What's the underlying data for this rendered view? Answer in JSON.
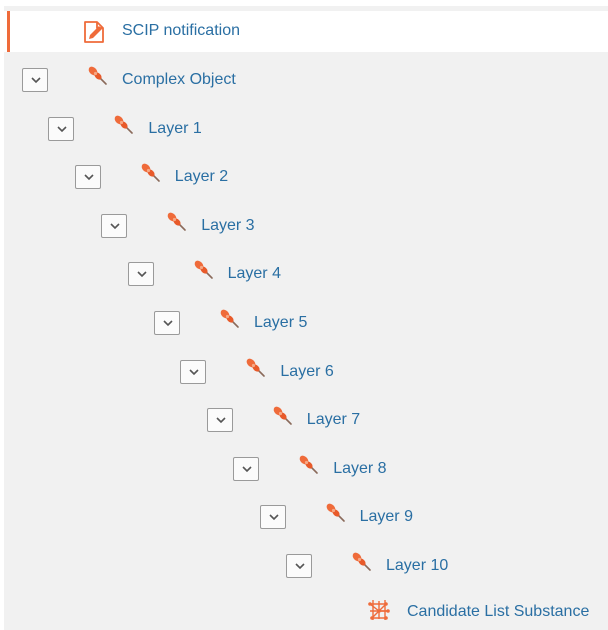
{
  "colors": {
    "accent": "#ef6b3a",
    "link": "#2a6fa3",
    "panel_bg": "#f1f1f1"
  },
  "notification": {
    "label": "SCIP notification",
    "icon": "edit-document-icon"
  },
  "tree": [
    {
      "label": "Complex Object",
      "icon": "pushpin-icon",
      "expanded": true
    },
    {
      "label": "Layer 1",
      "icon": "pushpin-icon",
      "expanded": true
    },
    {
      "label": "Layer 2",
      "icon": "pushpin-icon",
      "expanded": true
    },
    {
      "label": "Layer 3",
      "icon": "pushpin-icon",
      "expanded": true
    },
    {
      "label": "Layer 4",
      "icon": "pushpin-icon",
      "expanded": true
    },
    {
      "label": "Layer 5",
      "icon": "pushpin-icon",
      "expanded": true
    },
    {
      "label": "Layer 6",
      "icon": "pushpin-icon",
      "expanded": true
    },
    {
      "label": "Layer 7",
      "icon": "pushpin-icon",
      "expanded": true
    },
    {
      "label": "Layer 8",
      "icon": "pushpin-icon",
      "expanded": true
    },
    {
      "label": "Layer 9",
      "icon": "pushpin-icon",
      "expanded": true
    },
    {
      "label": "Layer 10",
      "icon": "pushpin-icon",
      "expanded": true
    }
  ],
  "candidate": {
    "label": "Candidate List Substance",
    "icon": "molecule-icon"
  }
}
